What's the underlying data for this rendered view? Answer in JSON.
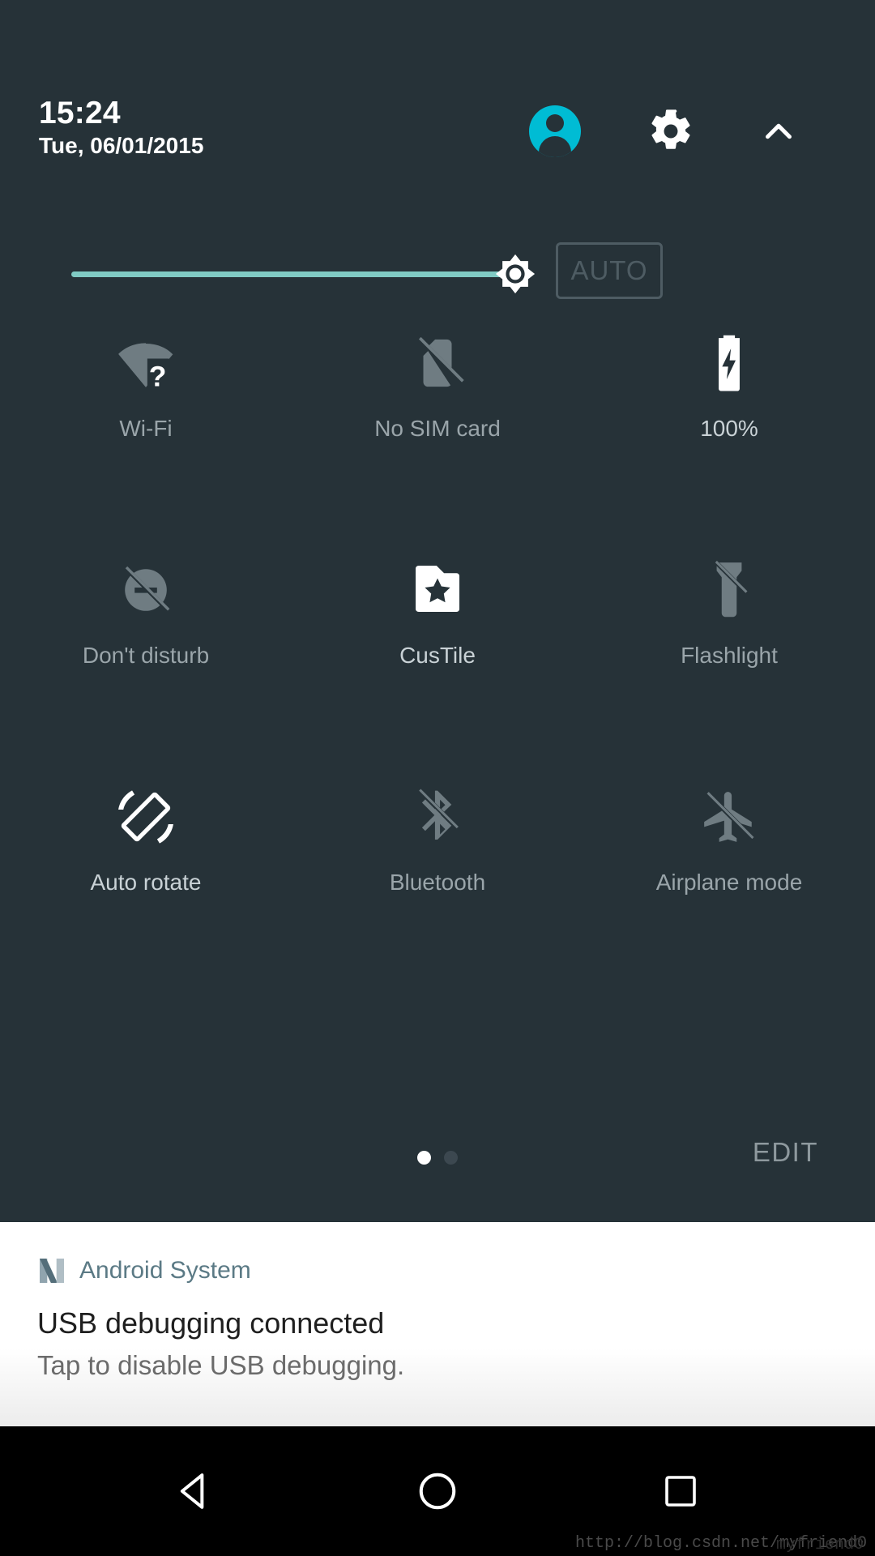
{
  "status": {
    "time": "15:24",
    "date": "Tue, 06/01/2015"
  },
  "header": {
    "avatar_icon": "user-avatar-icon",
    "settings_icon": "gear-icon",
    "collapse_icon": "chevron-up-icon",
    "accent_color": "#00bcd4"
  },
  "brightness": {
    "auto_label": "AUTO",
    "level_percent": 92,
    "track_color": "#80cbc4",
    "thumb_icon": "brightness-sun-icon"
  },
  "tiles": [
    [
      {
        "label": "Wi-Fi",
        "icon": "wifi-question-icon",
        "state": "off"
      },
      {
        "label": "No SIM card",
        "icon": "sim-card-off-icon",
        "state": "off"
      },
      {
        "label": "100%",
        "icon": "battery-charging-icon",
        "state": "on"
      }
    ],
    [
      {
        "label": "Don't disturb",
        "icon": "do-not-disturb-off-icon",
        "state": "off"
      },
      {
        "label": "CusTile",
        "icon": "folder-star-icon",
        "state": "on"
      },
      {
        "label": "Flashlight",
        "icon": "flashlight-off-icon",
        "state": "off"
      }
    ],
    [
      {
        "label": "Auto rotate",
        "icon": "screen-rotation-icon",
        "state": "on"
      },
      {
        "label": "Bluetooth",
        "icon": "bluetooth-disabled-icon",
        "state": "off"
      },
      {
        "label": "Airplane mode",
        "icon": "airplane-off-icon",
        "state": "off"
      }
    ]
  ],
  "footer": {
    "edit_label": "EDIT",
    "pages": 2,
    "active_page": 1
  },
  "notification": {
    "app_name": "Android System",
    "app_icon": "android-n-logo-icon",
    "title": "USB debugging connected",
    "body": "Tap to disable USB debugging.",
    "app_name_color": "#5b7a85"
  },
  "navbar": {
    "back_icon": "back-triangle-icon",
    "home_icon": "home-circle-icon",
    "recents_icon": "recents-square-icon"
  },
  "watermark": {
    "text": "http://blog.csdn.net/myfriend0",
    "overlay_text": "myfriend0"
  }
}
